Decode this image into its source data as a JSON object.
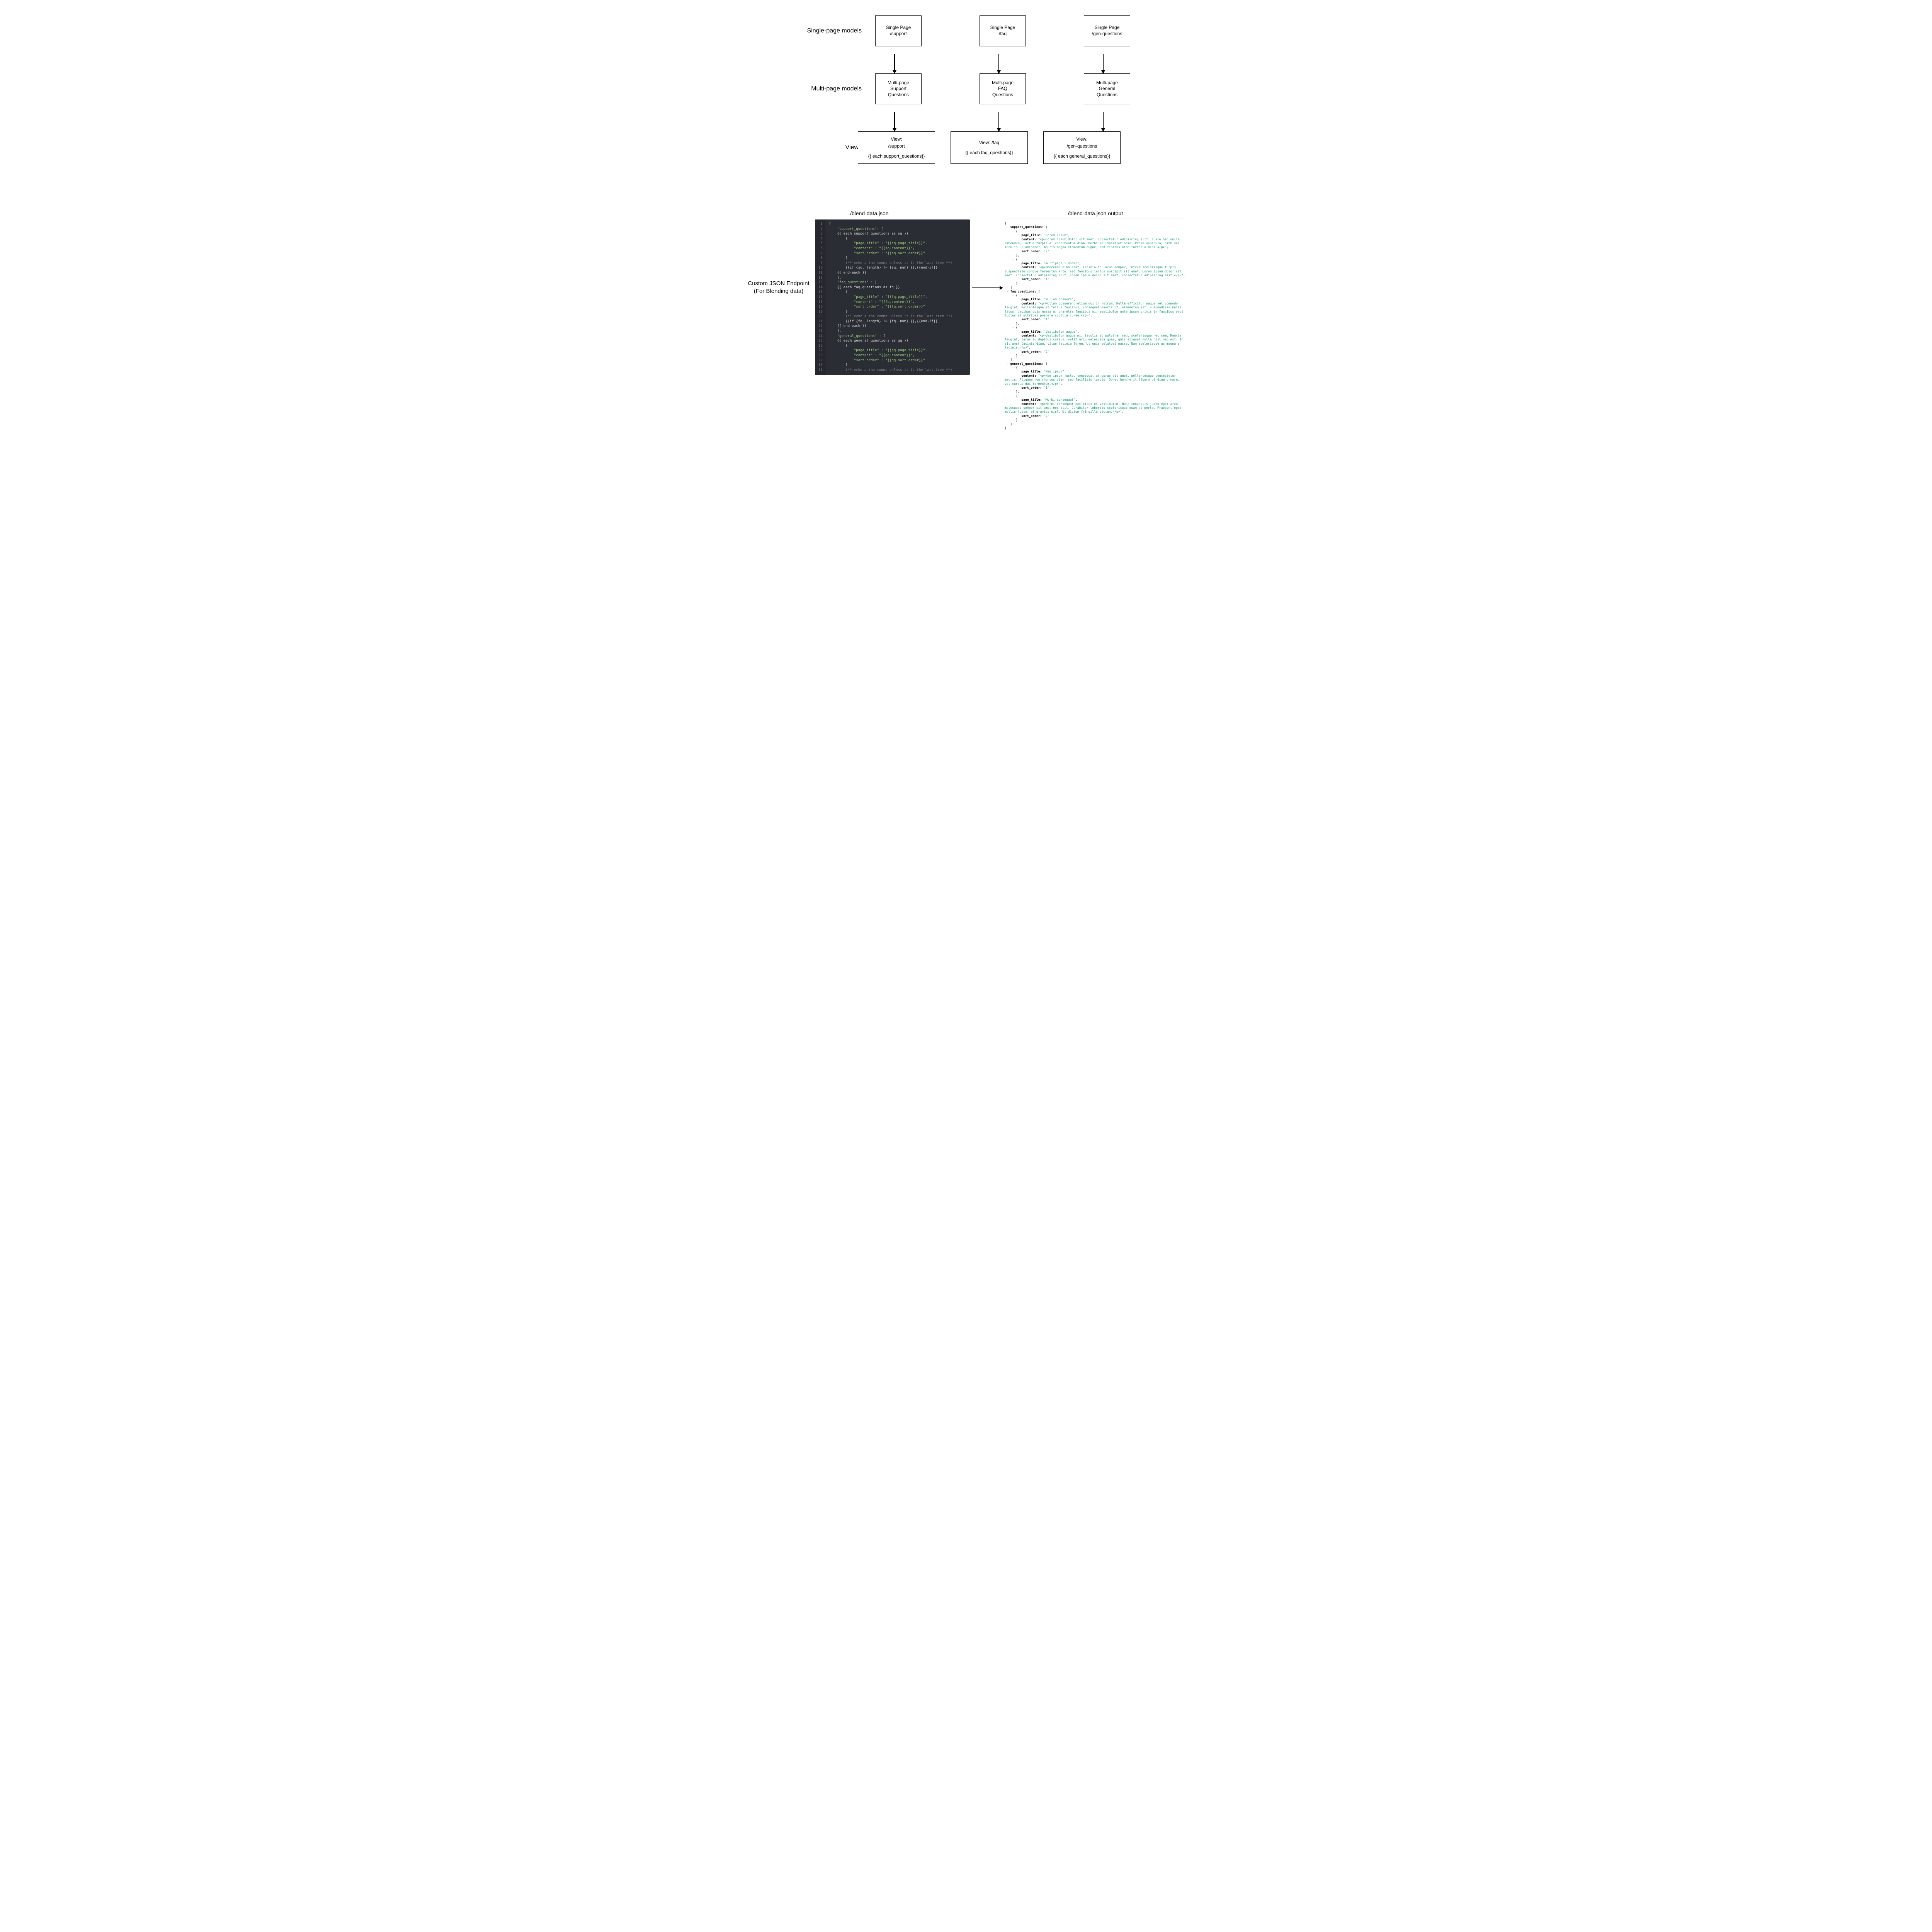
{
  "rows": {
    "single_label": "Single-page models",
    "multi_label": "Multi-page models",
    "views_label": "Views",
    "single": [
      {
        "l1": "Single Page",
        "l2": "/support"
      },
      {
        "l1": "Single Page",
        "l2": "/faq"
      },
      {
        "l1": "Single Page",
        "l2": "/gen-questions"
      }
    ],
    "multi": [
      {
        "l1": "Multi-page",
        "l2": "Support",
        "l3": "Questions"
      },
      {
        "l1": "Multi-page",
        "l2": "FAQ",
        "l3": "Questions"
      },
      {
        "l1": "Multi-page",
        "l2": "General",
        "l3": "Questions"
      }
    ],
    "views": [
      {
        "l1": "View:",
        "l2": "/support",
        "l3": "{{ each support_questions}}"
      },
      {
        "l1": "View: /faq",
        "l2": "",
        "l3": "{{ each faq_questions}}"
      },
      {
        "l1": "View:",
        "l2": "/gen-questions",
        "l3": "{{ each general_questions}}"
      }
    ]
  },
  "endpoint_label_l1": "Custom JSON Endpoint",
  "endpoint_label_l2": "(For Blending data)",
  "code_title": "/blend-data.json",
  "output_title": "/blend-data.json output",
  "code_lines": [
    {
      "n": 1,
      "t": "{"
    },
    {
      "n": 2,
      "t": "    \"support_questions\": ["
    },
    {
      "n": 3,
      "t": "    {{ each support_questions as sq }}"
    },
    {
      "n": 4,
      "t": "        {"
    },
    {
      "n": 5,
      "t": "            \"page_title\" : \"{{sq.page_title}}\","
    },
    {
      "n": 6,
      "t": "            \"content\" : \"{{sq.content}}\","
    },
    {
      "n": 7,
      "t": "            \"sort_order\" : \"{{sq.sort_order}}\""
    },
    {
      "n": 8,
      "t": "        }"
    },
    {
      "n": 9,
      "t": "        (** echo a the comma unless it is the last item **)"
    },
    {
      "n": 10,
      "t": "        {{if {sq._length} != {sq._num} }},{{end-if}}"
    },
    {
      "n": 11,
      "t": "    {{ end-each }}"
    },
    {
      "n": 12,
      "t": "    ],"
    },
    {
      "n": 13,
      "t": "    \"faq_questions\" : ["
    },
    {
      "n": 14,
      "t": "    {{ each faq_questions as fq }}"
    },
    {
      "n": 15,
      "t": "        {"
    },
    {
      "n": 16,
      "t": "            \"page_title\" : \"{{fq.page_title}}\","
    },
    {
      "n": 17,
      "t": "            \"content\" : \"{{fq.content}}\","
    },
    {
      "n": 18,
      "t": "            \"sort_order\" : \"{{fq.sort_order}}\""
    },
    {
      "n": 19,
      "t": "        }"
    },
    {
      "n": 20,
      "t": "        (** echo a the comma unless it is the last item **)"
    },
    {
      "n": 21,
      "t": "        {{if {fq._length} != {fq._num} }},{{end-if}}"
    },
    {
      "n": 22,
      "t": "    {{ end-each }}"
    },
    {
      "n": 23,
      "t": "    ],"
    },
    {
      "n": 24,
      "t": "    \"general_questions\" : ["
    },
    {
      "n": 25,
      "t": "    {{ each general_questions as gq }}"
    },
    {
      "n": 26,
      "t": "        {"
    },
    {
      "n": 27,
      "t": "            \"page_title\" : \"{{gq.page_title}}\","
    },
    {
      "n": 28,
      "t": "            \"content\" : \"{{gq.content}}\","
    },
    {
      "n": 29,
      "t": "            \"sort_order\" : \"{{gq.sort_order}}\""
    },
    {
      "n": 30,
      "t": "        }"
    },
    {
      "n": 31,
      "t": "        (** echo a the comma unless it is the last item **)"
    }
  ],
  "output": {
    "support_questions": [
      {
        "page_title": "Lorem Ipsum",
        "content": "<p>Lorem ipsum dolor sit amet, consectetur adipiscing elit. Fusce nec nulla bibendum, luctus turpis a, condimentum diam. Morbi id imperdiet odio. Proin vehicula, nibh vel iaculis ullamcorper, mauris magna elementum augue, sed finibus nibh tortor a nisi.</p>",
        "sort_order": "2"
      },
      {
        "page_title": "multipage 1 model",
        "content": "<p>Maecenas nibh erat, lacinia id lacus semper, rutrum scelerisque turpis. Suspendisse congue fermentum ante, sed faucibus lectus suscipit sit amet. Lorem ipsum dolor sit amet, consectetur adipiscing elit. Lorem ipsum dolor sit amet, consectetur adipiscing elit.</p>",
        "sort_order": "1"
      }
    ],
    "faq_questions": [
      {
        "page_title": "Nullam posuere",
        "content": "<p>Nullam posuere pretium dui in rutrum. Nulla efficitur neque vel commodo feugiat. Pellentesque at tellus faucibus, consequat mauris ut, elementum est. Suspendisse nulla lacus, dapibus quis massa a, pharetra faucibus mi. Vestibulum ante ipsum primis in faucibus orci luctus et ultrices posuere cubilia curae.</p>",
        "sort_order": "1"
      },
      {
        "page_title": "Vestibulum augue",
        "content": "<p>Vestibulum augue mi, iaculis et pulvinar sed, scelerisque nec sem. Mauris feugiat, lacus eu dapibus cursus, velit arcu malesuada quam, quis aliquet nulla nisl nec est. In sit amet lacinia diam, vitae lacinia lorem. Ut quis volutpat massa. Nam scelerisque ac magna a lacinia.</p>",
        "sort_order": "2"
      }
    ],
    "general_questions": [
      {
        "page_title": "Nam ipsum",
        "content": "<p>Nam ipsum justo, consequat at purus sit amet, pellentesque consectetur mauris. Aliquam non rhoncus diam, sed facilisis turpis. Donec hendrerit libero ut diam ornare, vel cursus dui fermentum.</p>",
        "sort_order": "1"
      },
      {
        "page_title": "Morbi consequat",
        "content": "<p>Morbi consequat nec risus et vestibulum. Nunc convallis justo eget arcu malesuada semper sit amet nec elit. Curabitur lobortis scelerisque quam at porta. Praesent eget mollis justo, at gravida nisl. Ut dictum fringilla dictum.</p>",
        "sort_order": "2"
      }
    ]
  }
}
